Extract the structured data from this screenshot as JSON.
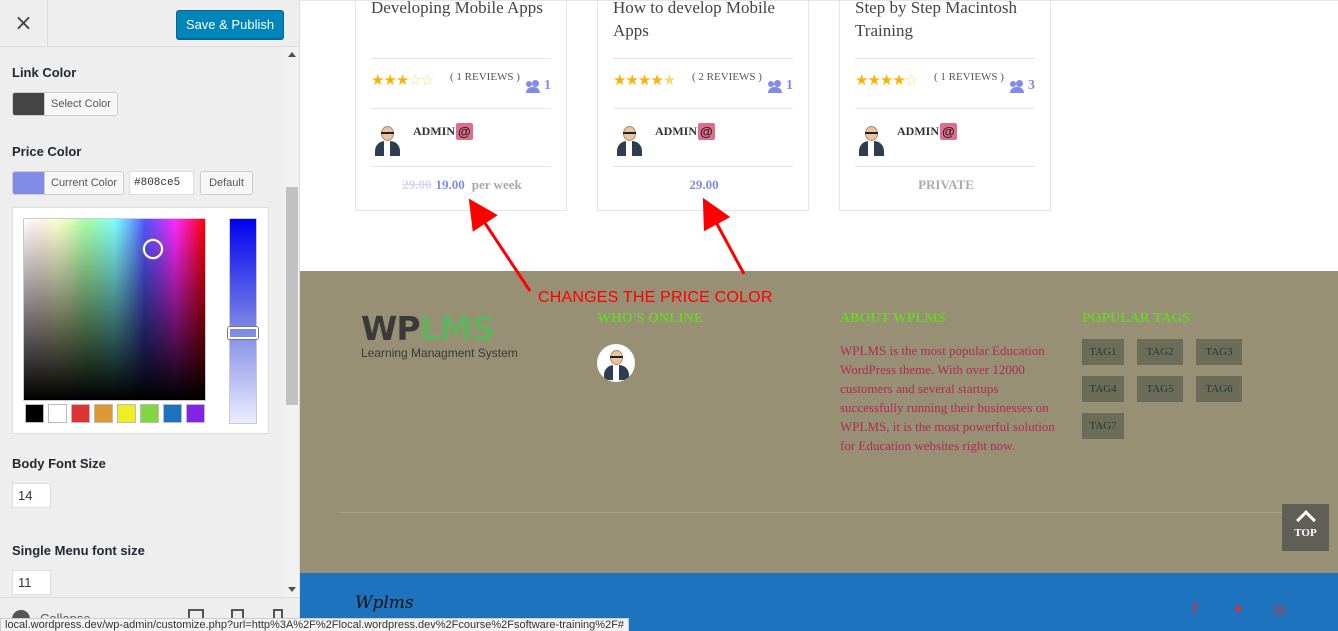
{
  "customizer": {
    "close_label": "×",
    "publish_label": "Save & Publish",
    "link_color": {
      "label": "Link Color",
      "button_label": "Select Color",
      "swatch_color": "#444444"
    },
    "price_color": {
      "label": "Price Color",
      "button_label": "Current Color",
      "value": "#808ce5",
      "default_label": "Default",
      "palette": [
        "#000000",
        "#ffffff",
        "#dd3333",
        "#dd9933",
        "#eeee22",
        "#81d742",
        "#1e73be",
        "#8224e3"
      ]
    },
    "body_font_size": {
      "label": "Body Font Size",
      "value": "14"
    },
    "single_menu_font_size": {
      "label": "Single Menu font size",
      "value": "11"
    },
    "collapse_label": "Collapse"
  },
  "status_bar_url": "local.wordpress.dev/wp-admin/customize.php?url=http%3A%2F%2Flocal.wordpress.dev%2Fcourse%2Fsoftware-training%2F#",
  "courses": [
    {
      "title": "Developing Mobile Apps",
      "rating": 3,
      "reviews": "( 1 REVIEWS )",
      "students": "1",
      "instructor": "ADMIN",
      "badge": "@",
      "old_price": "29.00",
      "price": "19.00",
      "period": "per week"
    },
    {
      "title": "How to develop Mobile Apps",
      "rating": 4.5,
      "reviews": "( 2 REVIEWS )",
      "students": "1",
      "instructor": "ADMIN",
      "badge": "@",
      "price": "29.00"
    },
    {
      "title": "Step by Step Macintosh Training",
      "rating": 4,
      "reviews": "( 1 REVIEWS )",
      "students": "3",
      "instructor": "ADMIN",
      "badge": "@",
      "price": "PRIVATE"
    }
  ],
  "currency_glyph": "",
  "annotation": "CHANGES THE PRICE COLOR",
  "footer": {
    "logo_wp": "WP",
    "logo_lms": "LMS",
    "logo_subtitle": "Learning Managment System",
    "whos_online_heading": "WHO'S ONLINE",
    "about_heading": "ABOUT WPLMS",
    "about_text": "WPLMS is the most popular Education WordPress theme. With over 12000 customers and several startups successfully running their businesses on WPLMS, it is the most powerful solution for Education websites right now.",
    "tags_heading": "POPULAR TAGS",
    "tags": [
      "TAG1",
      "TAG2",
      "TAG3",
      "TAG4",
      "TAG5",
      "TAG6",
      "TAG7"
    ],
    "top_label": "TOP",
    "bottom_logo": "Wplms"
  },
  "colors": {
    "price": "#808ce5",
    "annotation": "#ff0000",
    "footer_bg": "#979075",
    "bottom_bar": "#1e73be",
    "heading_green": "#6ed02c",
    "about_text": "#b22a54"
  }
}
